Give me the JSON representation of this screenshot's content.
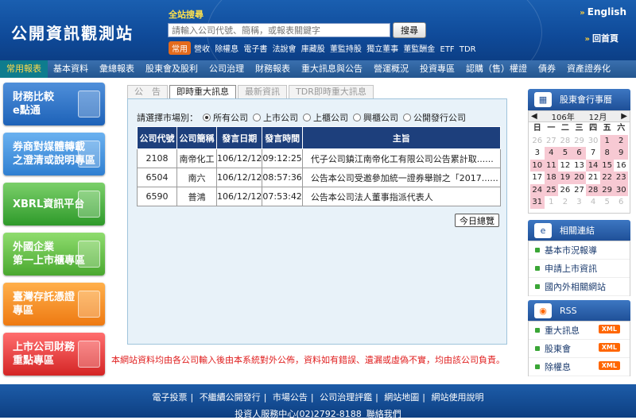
{
  "header": {
    "logo": "公開資訊觀測站",
    "search_label": "全站搜尋",
    "search_placeholder": "請輸入公司代號、簡稱，或報表關鍵字",
    "search_button": "搜尋",
    "common_badge": "常用",
    "common_links": [
      "營收",
      "除權息",
      "電子書",
      "法說會",
      "庫藏股",
      "董監持股",
      "獨立董事",
      "董監酬金",
      "ETF",
      "TDR"
    ],
    "english": "English",
    "home": "回首頁"
  },
  "nav": [
    "常用報表",
    "基本資料",
    "彙總報表",
    "股東會及股利",
    "公司治理",
    "財務報表",
    "重大訊息與公告",
    "營運概況",
    "投資專區",
    "認購（售）權證",
    "債券",
    "資產證券化"
  ],
  "banners": [
    {
      "line1": "財務比較",
      "line2": "e點通"
    },
    {
      "line1": "券商對媒體轉載",
      "line2": "之澄清或說明專區"
    },
    {
      "line1": "XBRL資訊平台",
      "line2": ""
    },
    {
      "line1": "外國企業",
      "line2": "第一上市櫃專區"
    },
    {
      "line1": "臺灣存託憑證",
      "line2": "專區"
    },
    {
      "line1": "上市公司財務",
      "line2": "重點專區"
    }
  ],
  "tabs": [
    "公　告",
    "即時重大訊息",
    "最新資訊",
    "TDR即時重大訊息"
  ],
  "market": {
    "label": "請選擇市場別：",
    "options": [
      "所有公司",
      "上市公司",
      "上櫃公司",
      "興櫃公司",
      "公開發行公司"
    ]
  },
  "table": {
    "headers": [
      "公司代號",
      "公司簡稱",
      "發言日期",
      "發言時間",
      "主旨"
    ],
    "rows": [
      [
        "2108",
        "南帝化工",
        "106/12/12",
        "09:12:25",
        "代子公司鎮江南帝化工有限公司公告累計取......"
      ],
      [
        "6504",
        "南六",
        "106/12/12",
        "08:57:36",
        "公告本公司受邀參加統一證券舉辦之「2017......"
      ],
      [
        "6590",
        "普鴻",
        "106/12/12",
        "07:53:42",
        "公告本公司法人董事指派代表人"
      ]
    ]
  },
  "summary_button": "今日總覽",
  "disclaimer": "本網站資料均由各公司輸入後由本系統對外公佈，資料如有錯誤、遺漏或虛偽不實，均由該公司負責。",
  "calendar": {
    "title": "股東會行事曆",
    "year": "106年",
    "month": "12月",
    "prev": "◀",
    "next": "▶",
    "weekdays": [
      "日",
      "一",
      "二",
      "三",
      "四",
      "五",
      "六"
    ],
    "cells": [
      "26",
      "27",
      "28",
      "29",
      "30",
      "1",
      "2",
      "3",
      "4",
      "5",
      "6",
      "7",
      "8",
      "9",
      "10",
      "11",
      "12",
      "13",
      "14",
      "15",
      "16",
      "17",
      "18",
      "19",
      "20",
      "21",
      "22",
      "23",
      "24",
      "25",
      "26",
      "27",
      "28",
      "29",
      "30",
      "31",
      "1",
      "2",
      "3",
      "4",
      "5",
      "6"
    ]
  },
  "related": {
    "title": "相關連結",
    "items": [
      "基本市況報導",
      "申請上市資訊",
      "國內外相關網站"
    ]
  },
  "rss": {
    "title": "RSS",
    "xml": "XML",
    "items": [
      "重大訊息",
      "股東會",
      "除權息"
    ]
  },
  "footer": {
    "links": [
      "電子投票",
      "不繼續公開發行",
      "市場公告",
      "公司治理評鑑",
      "網站地圖",
      "網站使用說明"
    ],
    "contact": "投資人服務中心(02)2792-8188",
    "contact_link": "聯絡我們"
  }
}
